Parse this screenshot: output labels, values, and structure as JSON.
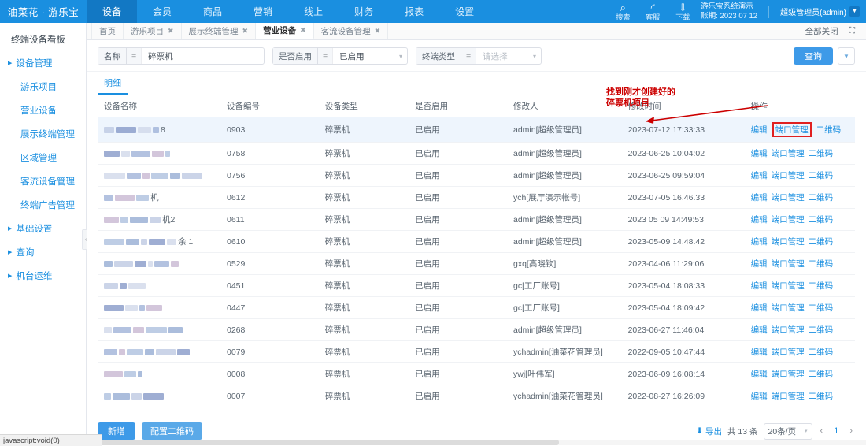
{
  "header": {
    "logo": "油菜花 · 游乐宝",
    "nav": [
      {
        "label": "设备",
        "active": true
      },
      {
        "label": "会员",
        "active": false
      },
      {
        "label": "商品",
        "active": false
      },
      {
        "label": "营销",
        "active": false
      },
      {
        "label": "线上",
        "active": false
      },
      {
        "label": "财务",
        "active": false
      },
      {
        "label": "报表",
        "active": false
      },
      {
        "label": "设置",
        "active": false
      }
    ],
    "tools": [
      {
        "icon": "search-icon",
        "glyph": "⌕",
        "label": "搜索"
      },
      {
        "icon": "headset-icon",
        "glyph": "◜",
        "label": "客服"
      },
      {
        "icon": "download-icon",
        "glyph": "⇩",
        "label": "下载"
      }
    ],
    "demo_name": "游乐宝系统演示",
    "period_label": "账期: 2023 07 12",
    "user": "超级管理员(admin)",
    "user_caret": "▼"
  },
  "sidebar": {
    "title": "终端设备看板",
    "items": [
      {
        "label": "设备管理",
        "type": "group",
        "expanded": true
      },
      {
        "label": "游乐项目",
        "type": "sub"
      },
      {
        "label": "营业设备",
        "type": "sub"
      },
      {
        "label": "展示终端管理",
        "type": "sub"
      },
      {
        "label": "区域管理",
        "type": "sub"
      },
      {
        "label": "客流设备管理",
        "type": "sub"
      },
      {
        "label": "终端广告管理",
        "type": "sub"
      },
      {
        "label": "基础设置",
        "type": "group"
      },
      {
        "label": "查询",
        "type": "group"
      },
      {
        "label": "机台运维",
        "type": "group"
      }
    ],
    "collapse_glyph": "‹"
  },
  "tabs": {
    "items": [
      {
        "label": "首页",
        "closable": false,
        "active": false
      },
      {
        "label": "游乐项目",
        "closable": true,
        "active": false
      },
      {
        "label": "展示终端管理",
        "closable": true,
        "active": false
      },
      {
        "label": "营业设备",
        "closable": true,
        "active": true
      },
      {
        "label": "客流设备管理",
        "closable": true,
        "active": false
      }
    ],
    "close_glyph": "✖",
    "close_all": "全部关闭",
    "fullscreen_icon": "⛶"
  },
  "search": {
    "fields": [
      {
        "label": "名称",
        "operator": "=",
        "value": "碎票机",
        "placeholder": "",
        "dropdown": false
      },
      {
        "label": "是否启用",
        "operator": "=",
        "value": "已启用",
        "placeholder": "",
        "dropdown": true
      },
      {
        "label": "终端类型",
        "operator": "=",
        "value": "",
        "placeholder": "请选择",
        "dropdown": true
      }
    ],
    "query_button": "查询",
    "more_glyph": "▼"
  },
  "inner_tab": "明细",
  "table": {
    "columns": [
      "设备名称",
      "设备编号",
      "设备类型",
      "是否启用",
      "修改人",
      "修改时间",
      "操作"
    ],
    "op_links": [
      "编辑",
      "端口管理",
      "二维码"
    ],
    "rows": [
      {
        "name_redacted": true,
        "name_suffix": "8",
        "code": "0903",
        "type": "碎票机",
        "enabled": "已启用",
        "modifier": "admin[超级管理员]",
        "time": "2023-07-12 17:33:33",
        "highlight": true
      },
      {
        "name_redacted": true,
        "name_suffix": "",
        "code": "0758",
        "type": "碎票机",
        "enabled": "已启用",
        "modifier": "admin[超级管理员]",
        "time": "2023-06-25 10:04:02",
        "highlight": false
      },
      {
        "name_redacted": true,
        "name_suffix": "",
        "code": "0756",
        "type": "碎票机",
        "enabled": "已启用",
        "modifier": "admin[超级管理员]",
        "time": "2023-06-25 09:59:04",
        "highlight": false
      },
      {
        "name_redacted": true,
        "name_suffix": "机",
        "code": "0612",
        "type": "碎票机",
        "enabled": "已启用",
        "modifier": "ych[展厅演示帐号]",
        "time": "2023-07-05 16.46.33",
        "highlight": false
      },
      {
        "name_redacted": true,
        "name_suffix": "机2",
        "code": "0611",
        "type": "碎票机",
        "enabled": "已启用",
        "modifier": "admin[超级管理员]",
        "time": "2023 05 09 14:49:53",
        "highlight": false
      },
      {
        "name_redacted": true,
        "name_suffix": "余 1",
        "code": "0610",
        "type": "碎票机",
        "enabled": "已启用",
        "modifier": "admin[超级管理员]",
        "time": "2023-05-09 14.48.42",
        "highlight": false
      },
      {
        "name_redacted": true,
        "name_suffix": "",
        "code": "0529",
        "type": "碎票机",
        "enabled": "已启用",
        "modifier": "gxq[高晓钦]",
        "time": "2023-04-06 11:29:06",
        "highlight": false
      },
      {
        "name_redacted": true,
        "name_suffix": "",
        "code": "0451",
        "type": "碎票机",
        "enabled": "已启用",
        "modifier": "gc[工厂账号]",
        "time": "2023-05-04 18:08:33",
        "highlight": false
      },
      {
        "name_redacted": true,
        "name_suffix": "",
        "code": "0447",
        "type": "碎票机",
        "enabled": "已启用",
        "modifier": "gc[工厂账号]",
        "time": "2023-05-04 18:09:42",
        "highlight": false
      },
      {
        "name_redacted": true,
        "name_suffix": "",
        "code": "0268",
        "type": "碎票机",
        "enabled": "已启用",
        "modifier": "admin[超级管理员]",
        "time": "2023-06-27 11:46:04",
        "highlight": false
      },
      {
        "name_redacted": true,
        "name_suffix": "",
        "code": "0079",
        "type": "碎票机",
        "enabled": "已启用",
        "modifier": "ychadmin[油菜花管理员]",
        "time": "2022-09-05 10:47:44",
        "highlight": false
      },
      {
        "name_redacted": true,
        "name_suffix": "",
        "code": "0008",
        "type": "碎票机",
        "enabled": "已启用",
        "modifier": "ywj[叶伟军]",
        "time": "2023-06-09 16:08:14",
        "highlight": false
      },
      {
        "name_redacted": true,
        "name_suffix": "",
        "code": "0007",
        "type": "碎票机",
        "enabled": "已启用",
        "modifier": "ychadmin[油菜花管理员]",
        "time": "2022-08-27 16:26:09",
        "highlight": false
      }
    ]
  },
  "annotation": {
    "line1": "找到刚才创建好的",
    "line2": "碎票机项目",
    "color": "#cc0000"
  },
  "footer": {
    "add_button": "新增",
    "qr_button": "配置二维码",
    "export_icon": "⬇",
    "export_label": "导出",
    "total": "共 13 条",
    "page_size": "20条/页",
    "page_size_caret": "▾",
    "prev": "‹",
    "current_page": "1",
    "next": "›"
  },
  "status_bar": "javascript:void(0)"
}
